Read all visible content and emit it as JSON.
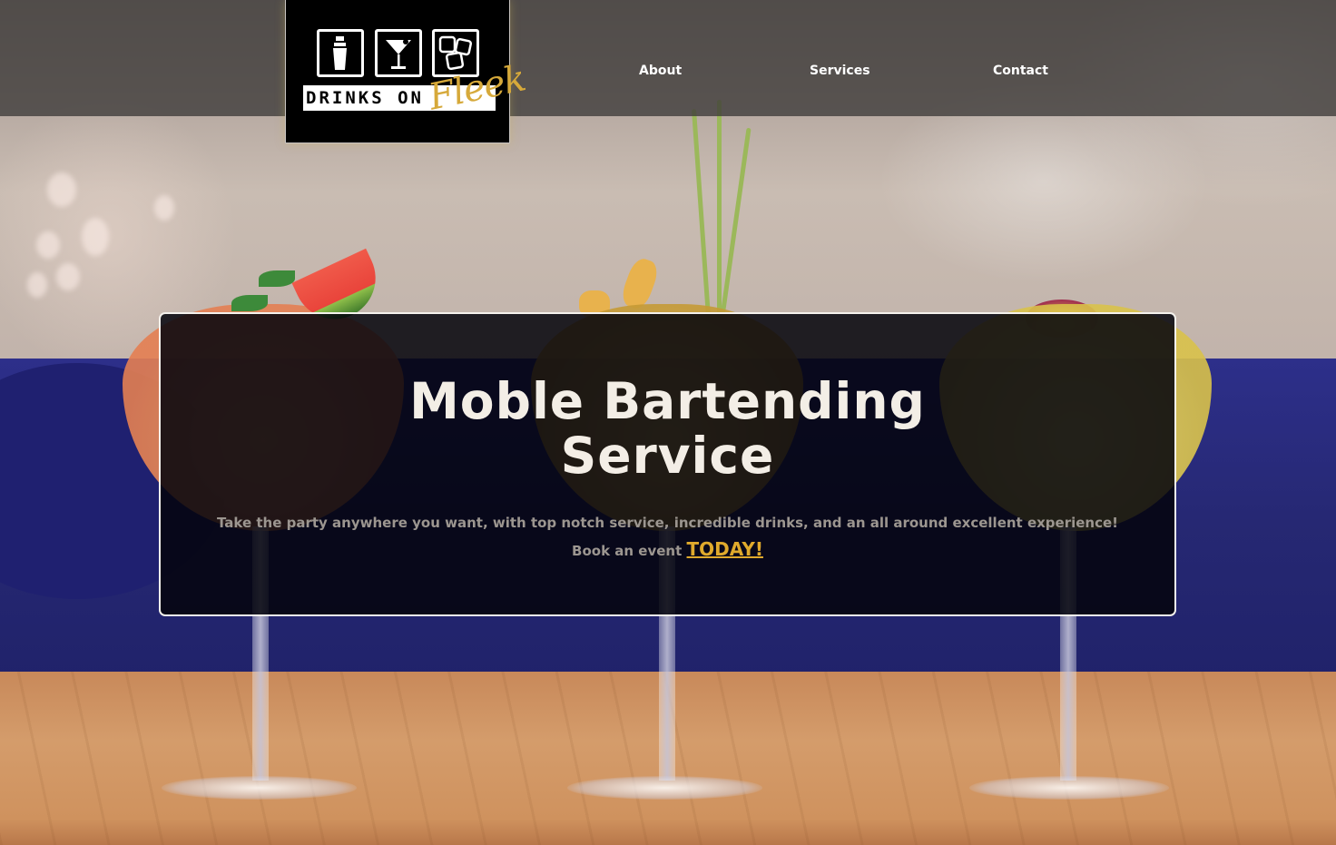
{
  "brand": {
    "logo_word": "DRINKS ON",
    "logo_script": "Fleek",
    "script_color": "#d6a93a",
    "icons": [
      "cocktail-shaker-icon",
      "martini-glass-icon",
      "ice-cubes-icon"
    ]
  },
  "nav": {
    "items": [
      {
        "label": "About"
      },
      {
        "label": "Services"
      },
      {
        "label": "Contact"
      }
    ]
  },
  "hero": {
    "title_line1": "Moble Bartending",
    "title_line2": "Service",
    "tagline": "Take the party anywhere you want, with top notch service, incredible drinks, and an all around excellent experience!",
    "cta_prefix": "Book an event",
    "cta_link": "TODAY!",
    "cta_color": "#e0aa2c"
  }
}
